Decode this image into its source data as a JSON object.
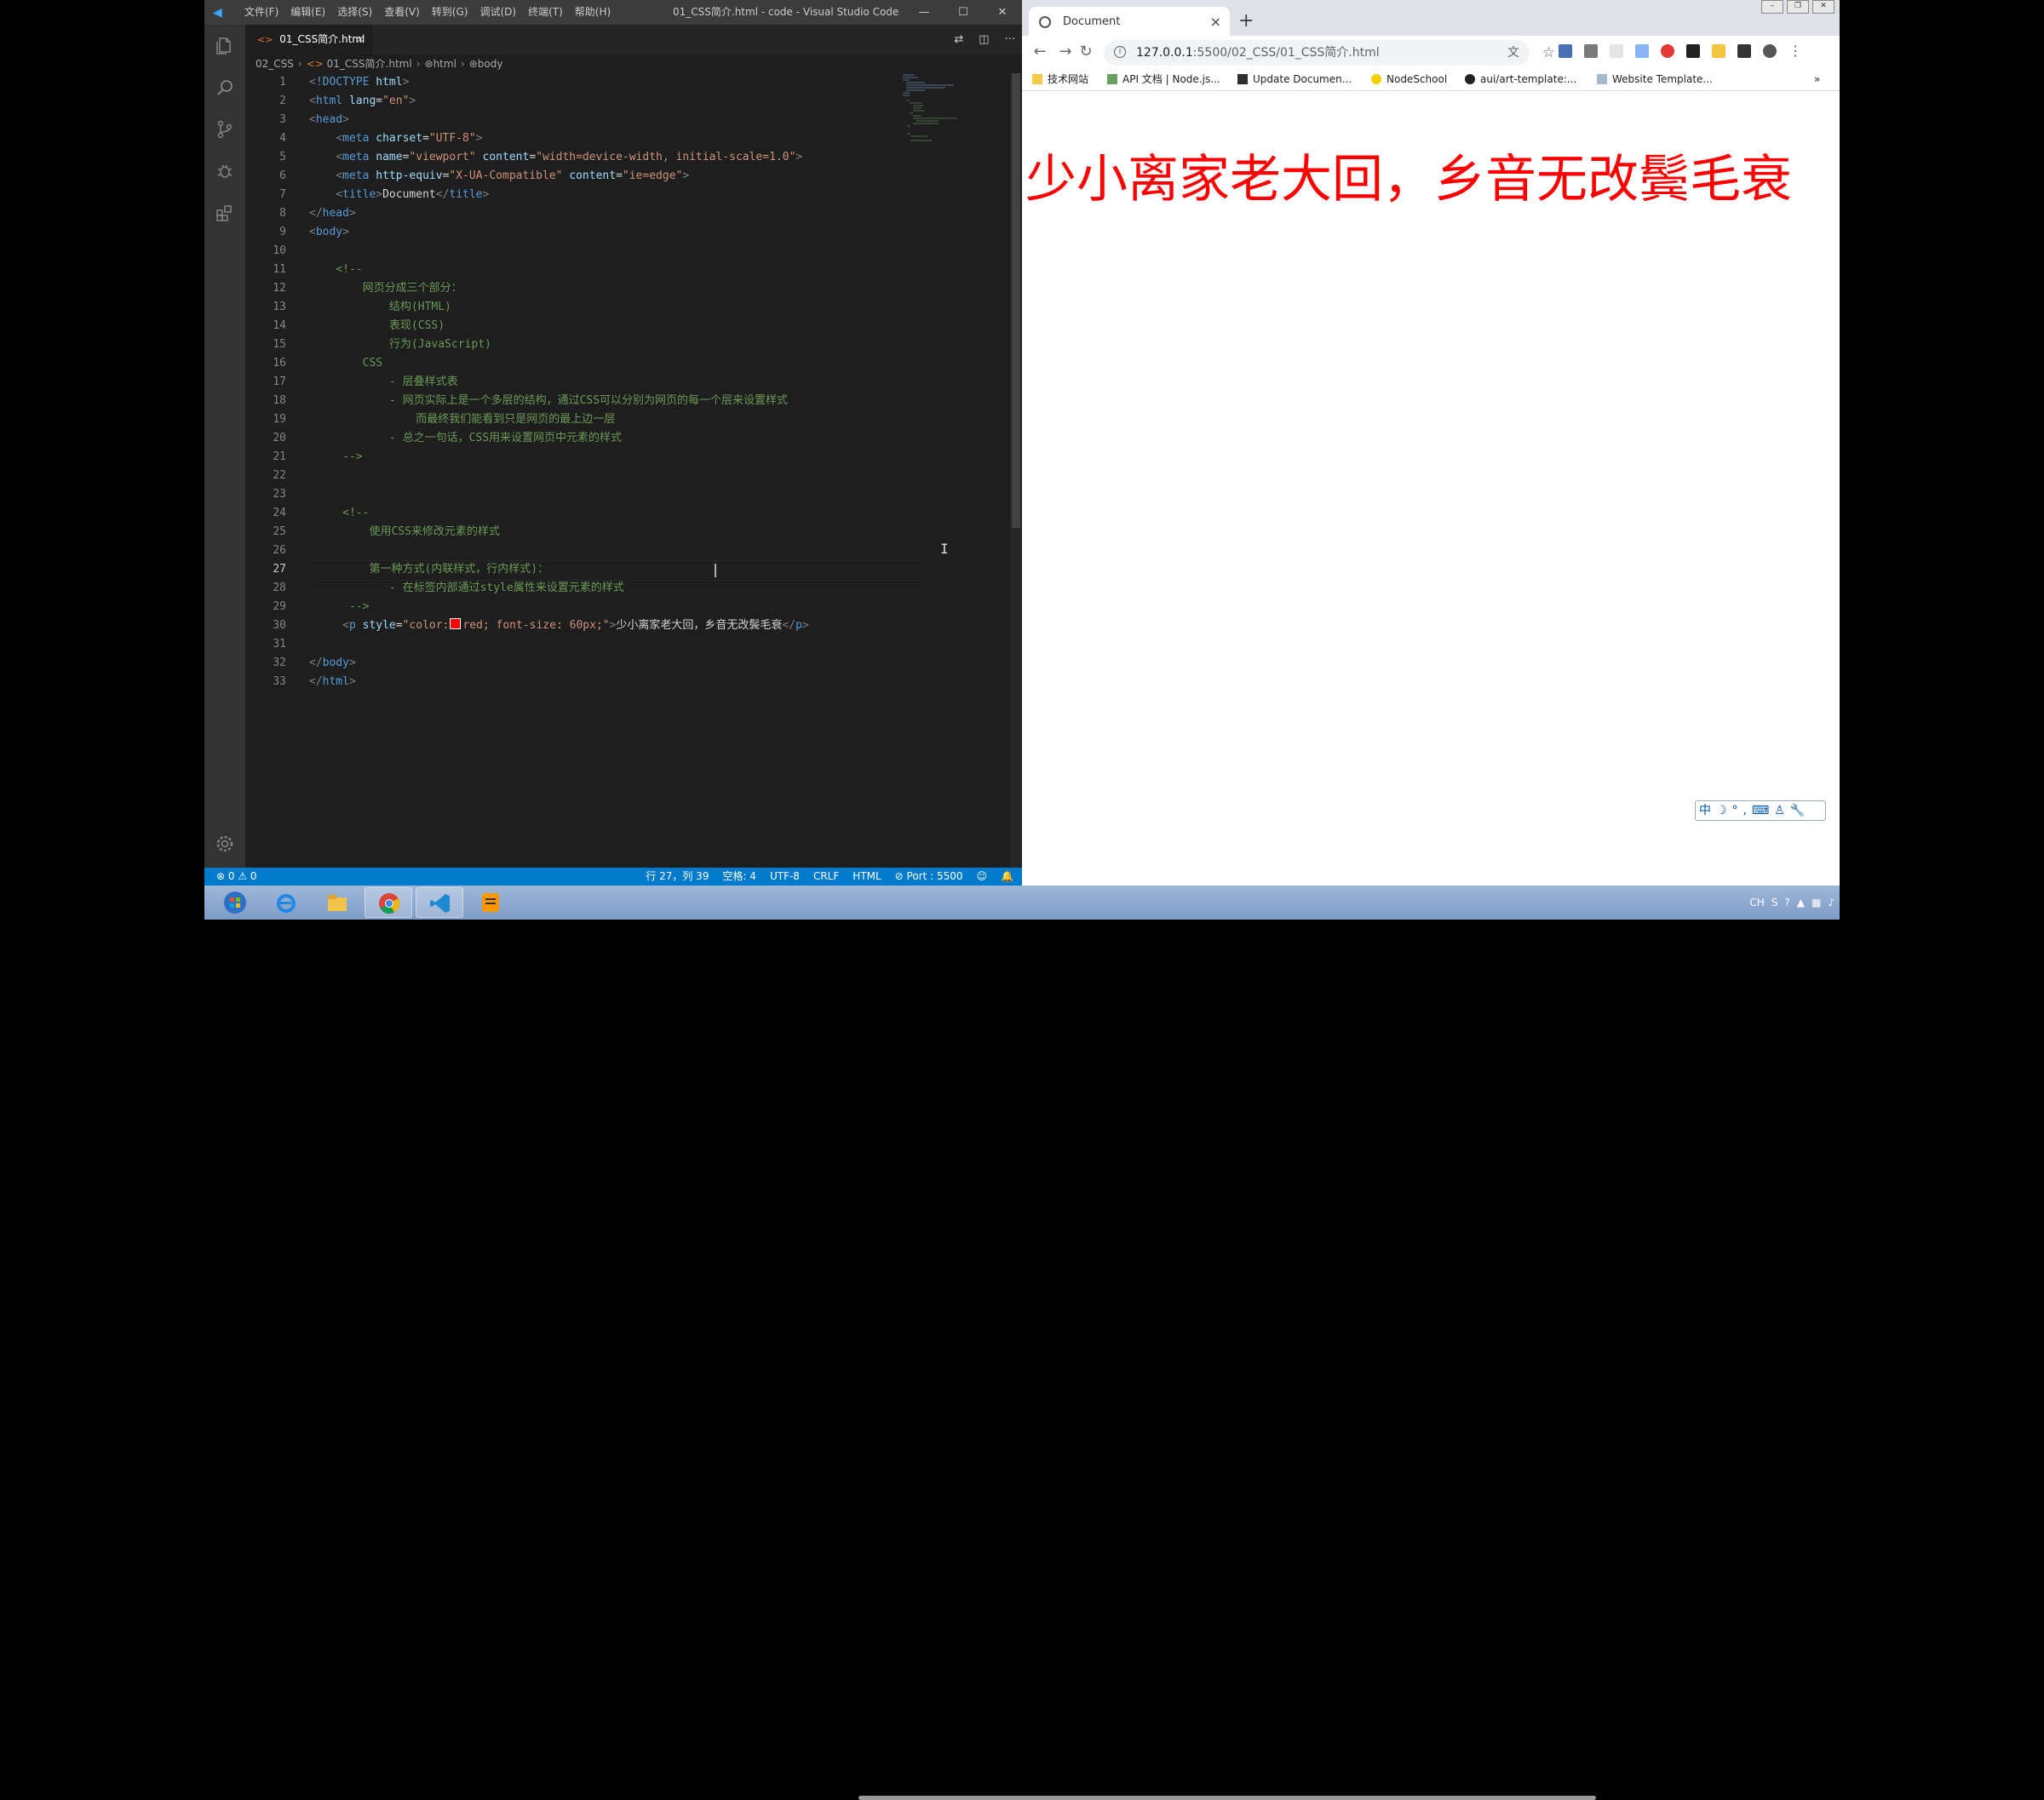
{
  "vscode": {
    "menus": [
      "文件(F)",
      "编辑(E)",
      "选择(S)",
      "查看(V)",
      "转到(G)",
      "调试(D)",
      "终端(T)",
      "帮助(H)"
    ],
    "window_title": "01_CSS简介.html - code - Visual Studio Code",
    "tab": {
      "label": "01_CSS简介.html",
      "tag": "<>",
      "close": "×"
    },
    "breadcrumb": [
      "02_CSS",
      "01_CSS简介.html",
      "html",
      "body"
    ],
    "line_numbers": [
      "1",
      "2",
      "3",
      "4",
      "5",
      "6",
      "7",
      "8",
      "9",
      "10",
      "11",
      "12",
      "13",
      "14",
      "15",
      "16",
      "17",
      "18",
      "19",
      "20",
      "21",
      "22",
      "23",
      "24",
      "25",
      "26",
      "27",
      "28",
      "29",
      "30",
      "31",
      "32",
      "33"
    ],
    "status": {
      "problems": "⊗ 0 ⚠ 0",
      "position": "行 27，列 39",
      "spaces": "空格: 4",
      "encoding": "UTF-8",
      "eol": "CRLF",
      "language": "HTML",
      "port": "⊘ Port : 5500",
      "smiley": "☺",
      "bell": "🔔"
    }
  },
  "code": {
    "l1": "<!DOCTYPE html>",
    "l7_text": "Document",
    "c12": "网页分成三个部分：",
    "c13": "结构(HTML)",
    "c14": "表现(CSS)",
    "c15": "行为(JavaScript)",
    "c16": "CSS",
    "c17": "- 层叠样式表",
    "c18": "- 网页实际上是一个多层的结构，通过CSS可以分别为网页的每一个层来设置样式",
    "c19": "而最终我们能看到只是网页的最上边一层",
    "c20": "- 总之一句话，CSS用来设置网页中元素的样式",
    "c25": "使用CSS来修改元素的样式",
    "c27": "第一种方式(内联样式，行内样式)：",
    "c28": "- 在标签内部通过style属性来设置元素的样式",
    "l30_text": "少小离家老大回，乡音无改鬓毛衰"
  },
  "chrome": {
    "tab_title": "Document",
    "url_host": "127.0.0.1",
    "url_path": ":5500/02_CSS/01_CSS简介.html",
    "bookmarks": [
      "技术网站",
      "API 文档 | Node.js...",
      "Update Documen...",
      "NodeSchool",
      "aui/art-template:...",
      "Website Template..."
    ],
    "page_text": "少小离家老大回，乡音无改鬓毛衰",
    "page_text_color": "#ff0000",
    "ime_bar": "中☽°,⌨♙🔧"
  },
  "tray": {
    "lang": "CH"
  }
}
